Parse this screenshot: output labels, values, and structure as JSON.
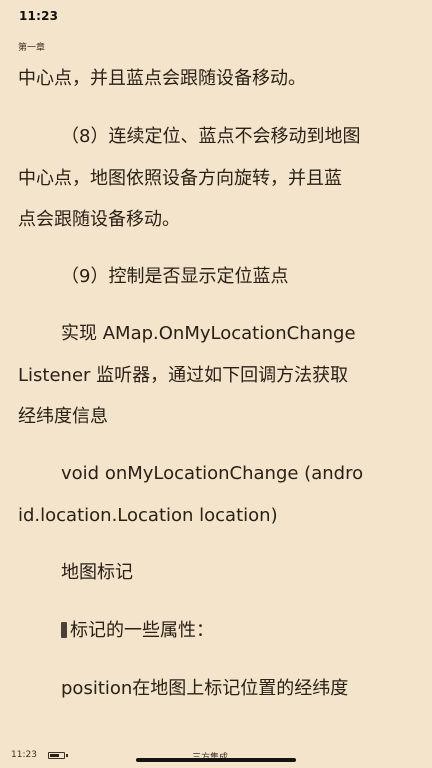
{
  "status_bar": {
    "time": "11:23"
  },
  "chapter": {
    "label": "第一章"
  },
  "content": {
    "lines": [
      "中心点，并且蓝点会跟随设备移动。",
      "（8）连续定位、蓝点不会移动到地图",
      "中心点，地图依照设备方向旋转，并且蓝",
      "点会跟随设备移动。",
      "（9）控制是否显示定位蓝点",
      "实现 AMap.OnMyLocationChange",
      "Listener 监听器，通过如下回调方法获取",
      "经纬度信息",
      "void onMyLocationChange (andro",
      "id.location.Location location)",
      "地图标记",
      "标记的一些属性：",
      "position在地图上标记位置的经纬度"
    ]
  },
  "footer": {
    "time": "11:23",
    "battery_level": 0.7,
    "book_title": "三方集成"
  }
}
